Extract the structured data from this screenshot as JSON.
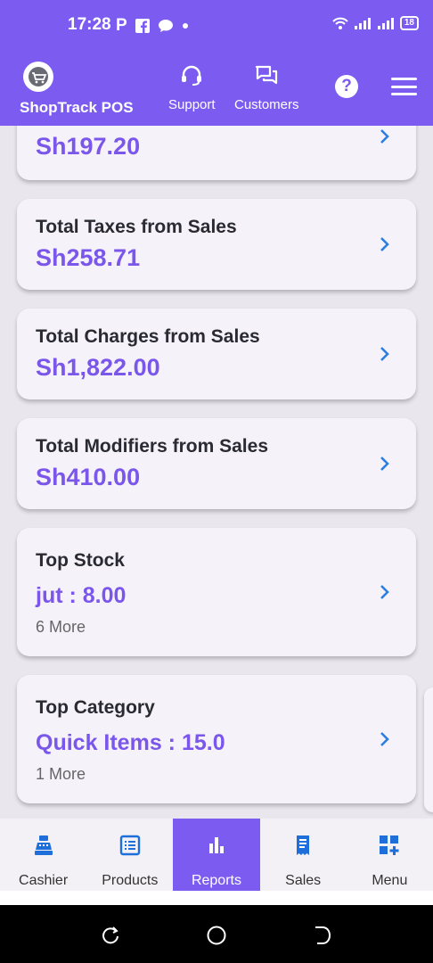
{
  "status_bar": {
    "time": "17:28",
    "battery": "18"
  },
  "header": {
    "app_name": "ShopTrack POS",
    "support_label": "Support",
    "customers_label": "Customers",
    "help_symbol": "?"
  },
  "cards": [
    {
      "title": "",
      "value": "Sh197.20"
    },
    {
      "title": "Total Taxes from Sales",
      "value": "Sh258.71"
    },
    {
      "title": "Total Charges from Sales",
      "value": "Sh1,822.00"
    },
    {
      "title": "Total Modifiers from Sales",
      "value": "Sh410.00"
    },
    {
      "title": "Top Stock",
      "value": "jut : 8.00",
      "more": "6 More"
    },
    {
      "title": "Top Category",
      "value": "Quick Items : 15.0",
      "more": "1 More"
    }
  ],
  "bottom_nav": {
    "active": "Reports",
    "items": [
      {
        "label": "Cashier",
        "icon": "cash-register-icon"
      },
      {
        "label": "Products",
        "icon": "list-icon"
      },
      {
        "label": "Reports",
        "icon": "bar-chart-icon"
      },
      {
        "label": "Sales",
        "icon": "receipt-icon"
      },
      {
        "label": "Menu",
        "icon": "grid-add-icon"
      }
    ]
  },
  "colors": {
    "primary": "#7c5cf0",
    "value_text": "#7a57ea",
    "chevron": "#2b7fe0",
    "card_bg": "#f6f2fa",
    "nav_icon": "#1e6fd9"
  }
}
